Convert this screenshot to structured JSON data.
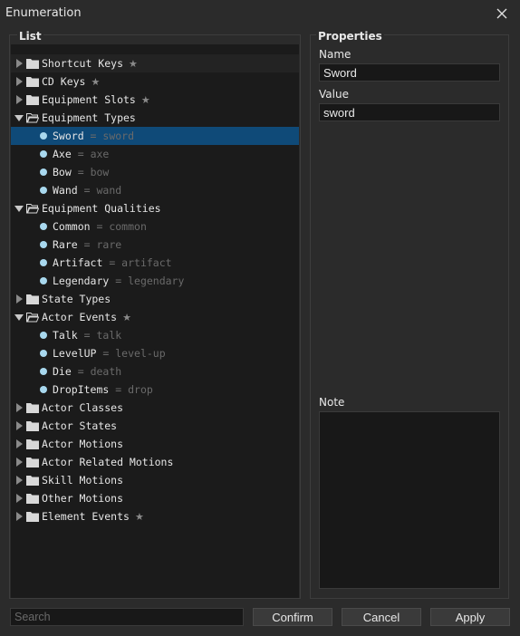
{
  "window": {
    "title": "Enumeration"
  },
  "list": {
    "label": "List"
  },
  "tree": [
    {
      "kind": "folder",
      "expanded": false,
      "label": "Shortcut Keys",
      "starred": true
    },
    {
      "kind": "folder",
      "expanded": false,
      "label": "CD Keys",
      "starred": true
    },
    {
      "kind": "folder",
      "expanded": false,
      "label": "Equipment Slots",
      "starred": true
    },
    {
      "kind": "folder",
      "expanded": true,
      "label": "Equipment Types",
      "starred": false
    },
    {
      "kind": "leaf",
      "label": "Sword",
      "value": "sword",
      "selected": true
    },
    {
      "kind": "leaf",
      "label": "Axe",
      "value": "axe"
    },
    {
      "kind": "leaf",
      "label": "Bow",
      "value": "bow"
    },
    {
      "kind": "leaf",
      "label": "Wand",
      "value": "wand"
    },
    {
      "kind": "folder",
      "expanded": true,
      "label": "Equipment Qualities",
      "starred": false
    },
    {
      "kind": "leaf",
      "label": "Common",
      "value": "common"
    },
    {
      "kind": "leaf",
      "label": "Rare",
      "value": "rare"
    },
    {
      "kind": "leaf",
      "label": "Artifact",
      "value": "artifact"
    },
    {
      "kind": "leaf",
      "label": "Legendary",
      "value": "legendary"
    },
    {
      "kind": "folder",
      "expanded": false,
      "label": "State Types",
      "starred": false
    },
    {
      "kind": "folder",
      "expanded": true,
      "label": "Actor Events",
      "starred": true
    },
    {
      "kind": "leaf",
      "label": "Talk",
      "value": "talk"
    },
    {
      "kind": "leaf",
      "label": "LevelUP",
      "value": "level-up"
    },
    {
      "kind": "leaf",
      "label": "Die",
      "value": "death"
    },
    {
      "kind": "leaf",
      "label": "DropItems",
      "value": "drop"
    },
    {
      "kind": "folder",
      "expanded": false,
      "label": "Actor Classes",
      "starred": false
    },
    {
      "kind": "folder",
      "expanded": false,
      "label": "Actor States",
      "starred": false
    },
    {
      "kind": "folder",
      "expanded": false,
      "label": "Actor Motions",
      "starred": false
    },
    {
      "kind": "folder",
      "expanded": false,
      "label": "Actor Related Motions",
      "starred": false
    },
    {
      "kind": "folder",
      "expanded": false,
      "label": "Skill Motions",
      "starred": false
    },
    {
      "kind": "folder",
      "expanded": false,
      "label": "Other Motions",
      "starred": false
    },
    {
      "kind": "folder",
      "expanded": false,
      "label": "Element Events",
      "starred": true
    }
  ],
  "properties": {
    "label": "Properties",
    "name_label": "Name",
    "name_value": "Sword",
    "value_label": "Value",
    "value_value": "sword",
    "note_label": "Note",
    "note_value": ""
  },
  "footer": {
    "search_placeholder": "Search",
    "confirm_label": "Confirm",
    "cancel_label": "Cancel",
    "apply_label": "Apply"
  },
  "colors": {
    "selection": "#0f4a78",
    "leaf_dot": "#a8d8ee",
    "value_text": "#6a6a6a"
  }
}
